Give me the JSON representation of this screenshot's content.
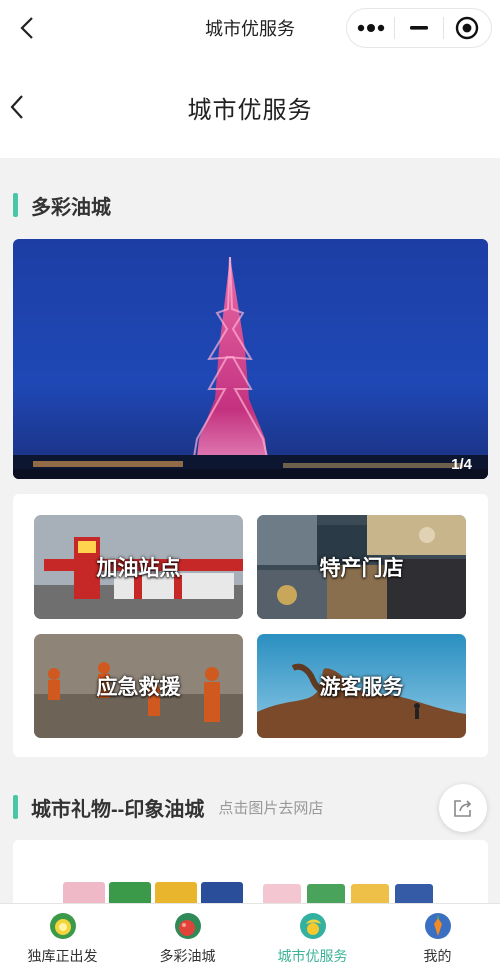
{
  "miniprogram_bar": {
    "title": "城市优服务"
  },
  "page_header": {
    "title": "城市优服务"
  },
  "section_colorful": {
    "title": "多彩油城",
    "banner_counter": "1/4"
  },
  "services": [
    {
      "label": "加油站点"
    },
    {
      "label": "特产门店"
    },
    {
      "label": "应急救援"
    },
    {
      "label": "游客服务"
    }
  ],
  "section_gifts": {
    "title": "城市礼物--印象油城",
    "hint": "点击图片去网店"
  },
  "tabbar": {
    "active_index": 2,
    "accent": "#3cb497",
    "items": [
      {
        "label": "独库正出发",
        "icon": "lemon-icon"
      },
      {
        "label": "多彩油城",
        "icon": "fruit-icon"
      },
      {
        "label": "城市优服务",
        "icon": "tea-icon"
      },
      {
        "label": "我的",
        "icon": "carrot-icon"
      }
    ]
  },
  "colors": {
    "section_bar": "#49c6a6",
    "page_bg": "#f2f2f2"
  }
}
